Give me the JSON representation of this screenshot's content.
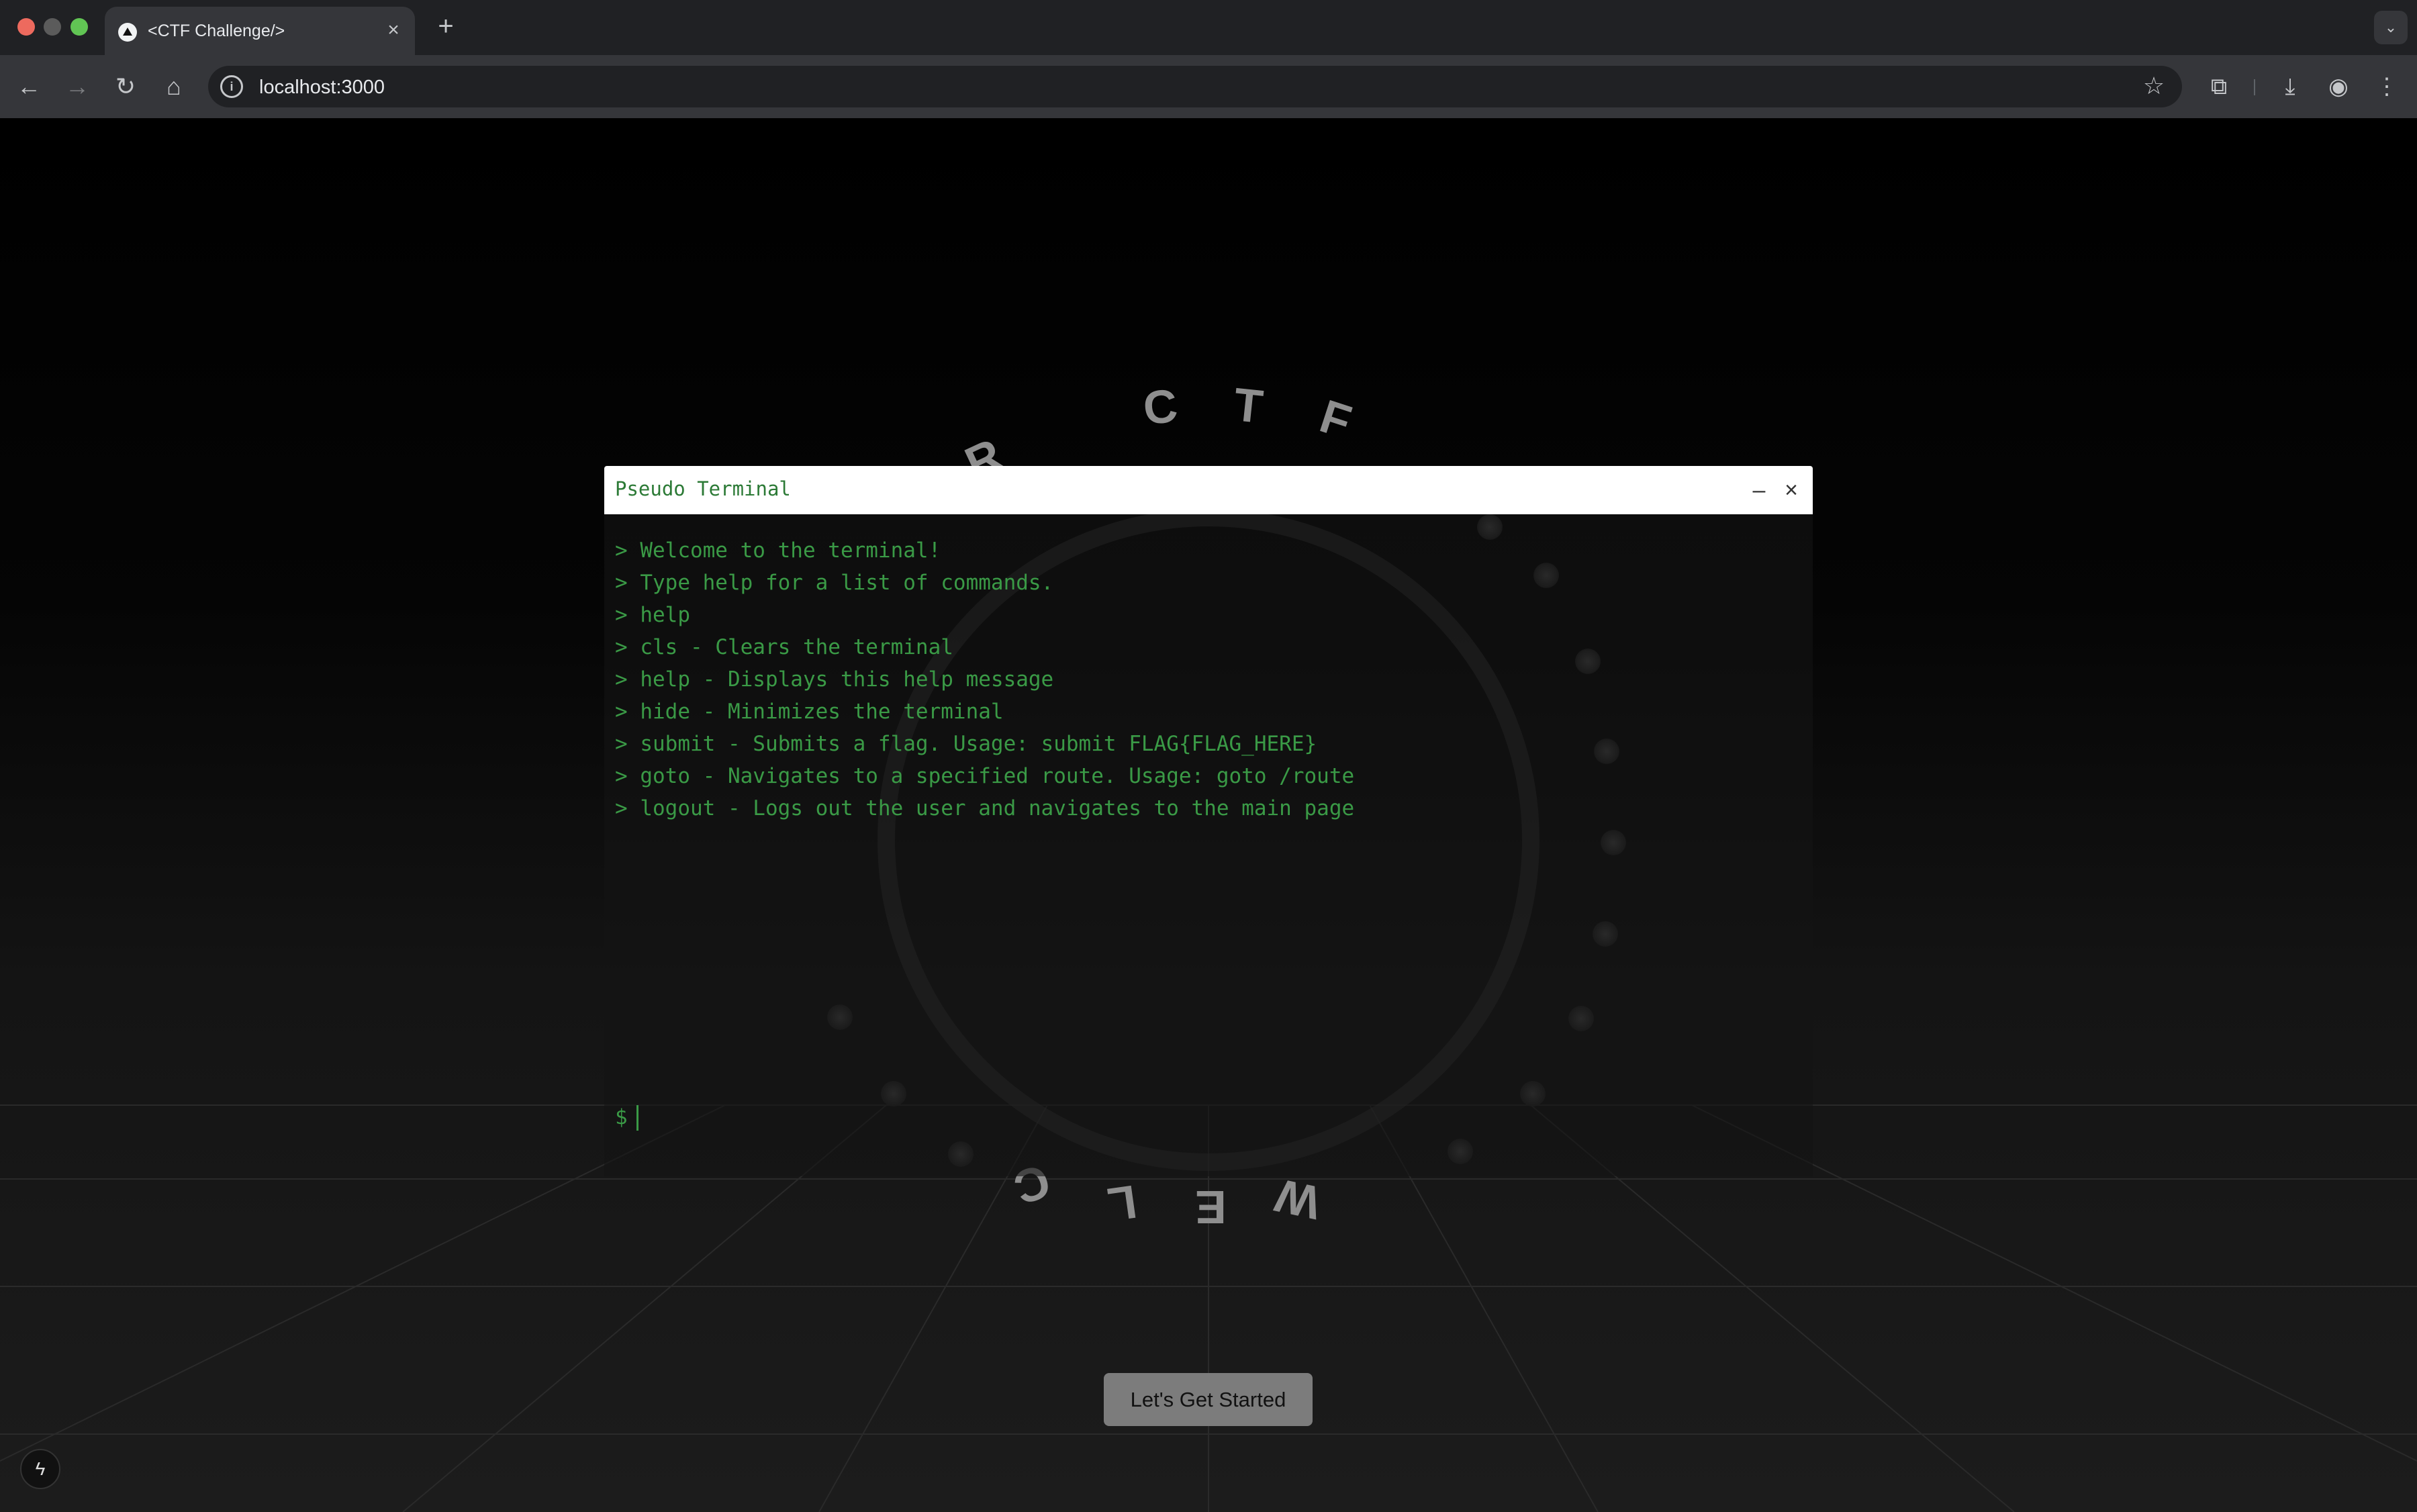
{
  "browser": {
    "tab_title": "<CTF Challenge/>",
    "tab_close": "×",
    "new_tab": "+",
    "tab_search": "⌄",
    "url": "localhost:3000",
    "icons": {
      "back": "←",
      "forward": "→",
      "reload": "↻",
      "home": "⌂",
      "site_info": "i",
      "bookmark": "☆",
      "extensions": "⧉",
      "download": "⤓",
      "profile": "◉",
      "menu": "⋮"
    }
  },
  "page": {
    "ring_letters_top": [
      "R",
      "C",
      "T",
      "F"
    ],
    "ring_letters_bottom": [
      "C",
      "L",
      "E",
      "W"
    ],
    "cta_label": "Let's Get Started",
    "badge_icon": "ϟ"
  },
  "terminal": {
    "title": "Pseudo Terminal",
    "minimize": "–",
    "close": "×",
    "lines": [
      "> Welcome to the terminal!",
      "> Type help for a list of commands.",
      "> help",
      "> cls - Clears the terminal",
      "> help - Displays this help message",
      "> hide - Minimizes the terminal",
      "> submit - Submits a flag. Usage: submit FLAG{FLAG_HERE}",
      "> goto - Navigates to a specified route. Usage: goto /route",
      "> logout - Logs out the user and navigates to the main page"
    ],
    "prompt": "$",
    "input_value": ""
  },
  "colors": {
    "terminal_text": "#3a9a46",
    "page_background": "#000000",
    "cta_background": "#7c7c7c"
  }
}
